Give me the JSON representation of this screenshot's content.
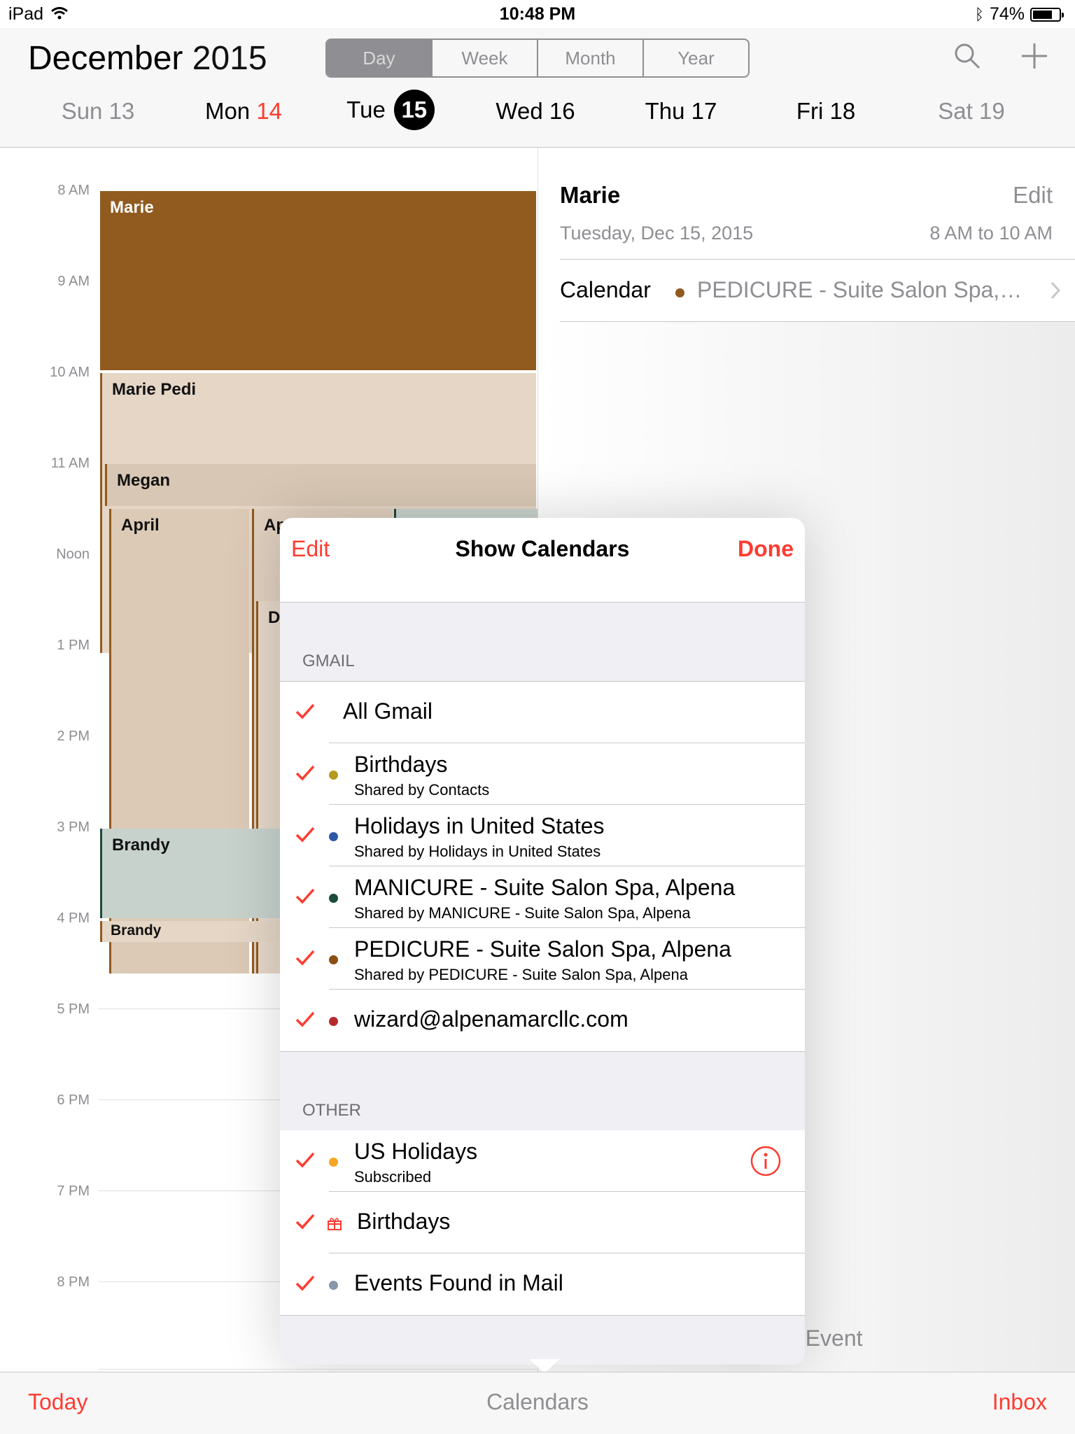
{
  "status": {
    "device": "iPad",
    "time": "10:48 PM",
    "battery": "74%",
    "battery_level": 0.74
  },
  "header": {
    "month": "December",
    "year": "2015",
    "views": [
      "Day",
      "Week",
      "Month",
      "Year"
    ],
    "selected_view": "Day",
    "days": [
      {
        "name": "Sun",
        "num": "13"
      },
      {
        "name": "Mon",
        "num": "14"
      },
      {
        "name": "Tue",
        "num": "15"
      },
      {
        "name": "Wed",
        "num": "16"
      },
      {
        "name": "Thu",
        "num": "17"
      },
      {
        "name": "Fri",
        "num": "18"
      },
      {
        "name": "Sat",
        "num": "19"
      }
    ]
  },
  "timeline": {
    "hours": [
      "8 AM",
      "9 AM",
      "10 AM",
      "11 AM",
      "Noon",
      "1 PM",
      "2 PM",
      "3 PM",
      "4 PM",
      "5 PM",
      "6 PM",
      "7 PM",
      "8 PM"
    ],
    "events": [
      "Marie",
      "Marie Pedi",
      "Megan",
      "April",
      "Ap",
      "D",
      "Brandy",
      "Brandy"
    ]
  },
  "detail": {
    "title": "Marie",
    "edit": "Edit",
    "date": "Tuesday, Dec 15, 2015",
    "time": "8 AM to 10 AM",
    "calendar_label": "Calendar",
    "calendar_value": "PEDICURE - Suite Salon Spa,…",
    "partial_text": "e Event"
  },
  "popover": {
    "edit": "Edit",
    "title": "Show Calendars",
    "done": "Done",
    "gmail_header": "GMAIL",
    "gmail": [
      {
        "title": "All Gmail",
        "sub": "",
        "color": ""
      },
      {
        "title": "Birthdays",
        "sub": "Shared by Contacts",
        "color": "#b59a1f"
      },
      {
        "title": "Holidays in United States",
        "sub": "Shared by Holidays in United States",
        "color": "#2e58a6"
      },
      {
        "title": "MANICURE - Suite Salon Spa, Alpena",
        "sub": "Shared by MANICURE - Suite Salon Spa, Alpena",
        "color": "#1c4b3a"
      },
      {
        "title": "PEDICURE - Suite Salon Spa, Alpena",
        "sub": "Shared by PEDICURE - Suite Salon Spa, Alpena",
        "color": "#8b4e17"
      },
      {
        "title": "wizard@alpenamarcllc.com",
        "sub": "",
        "color": "#b52a2a"
      }
    ],
    "other_header": "OTHER",
    "other": [
      {
        "title": "US Holidays",
        "sub": "Subscribed",
        "color": "#f5a623"
      },
      {
        "title": "Birthdays",
        "sub": "",
        "color": "#ff3b30"
      },
      {
        "title": "Events Found in Mail",
        "sub": "",
        "color": "#8a97a8"
      }
    ]
  },
  "toolbar": {
    "today": "Today",
    "calendars": "Calendars",
    "inbox": "Inbox"
  },
  "colors": {
    "accent": "#ff3b30",
    "pedicure": "#915a1f",
    "manicure": "#1c4b3a"
  }
}
